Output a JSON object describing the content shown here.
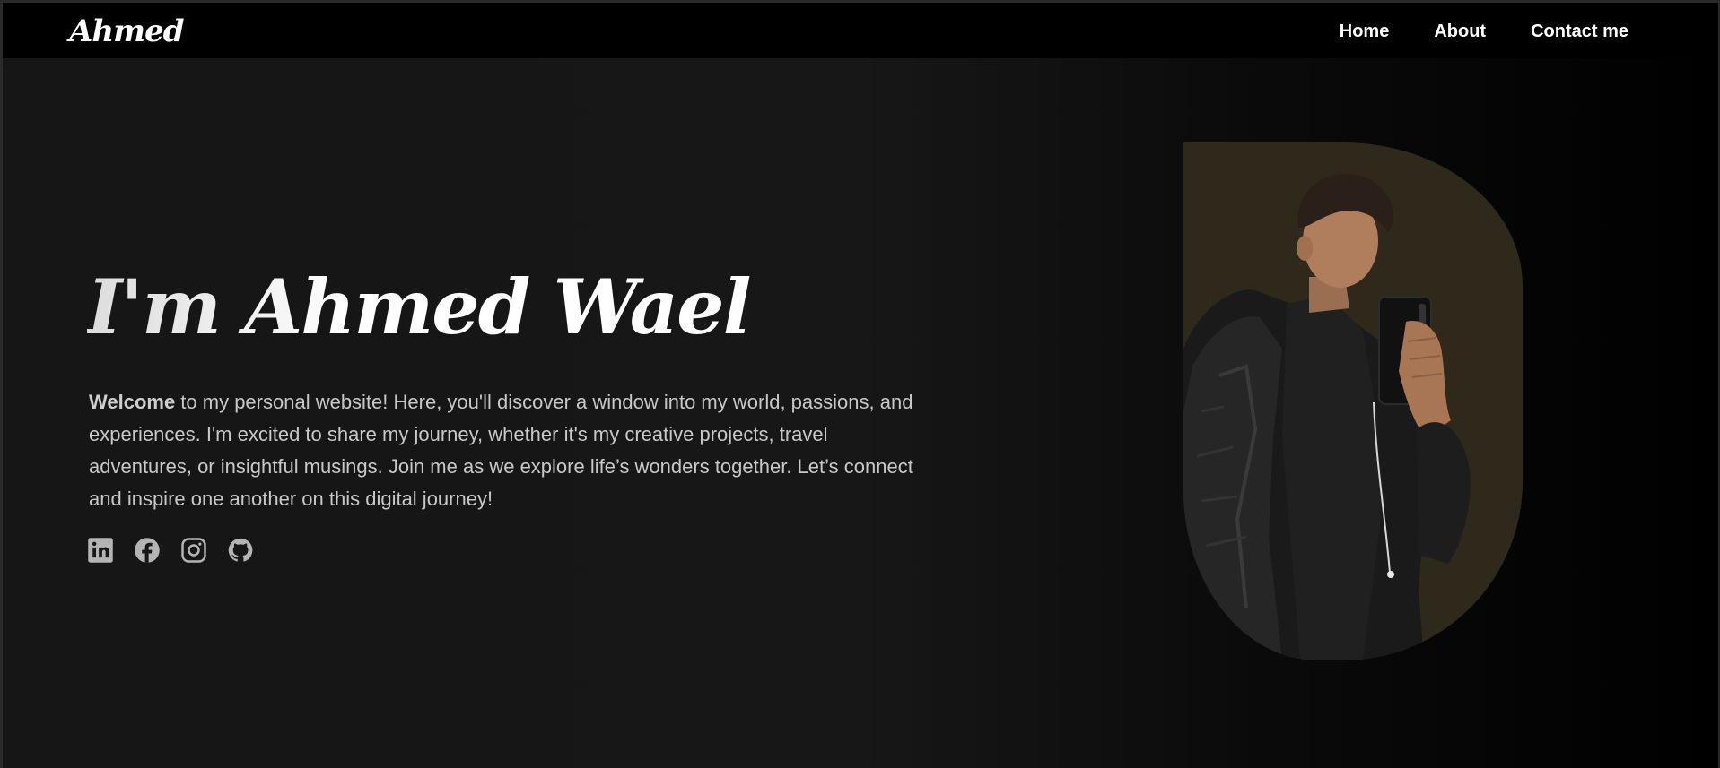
{
  "navbar": {
    "brand": "Ahmed",
    "links": [
      "Home",
      "About",
      "Contact me"
    ]
  },
  "hero": {
    "title": "I'm Ahmed Wael",
    "intro_bold": "Welcome",
    "intro_rest": " to my personal website! Here, you'll discover a window into my world, passions, and experiences. I'm excited to share my journey, whether it's my creative projects, travel adventures, or insightful musings. Join me as we explore life’s wonders together. Let’s connect and inspire one another on this digital journey!"
  },
  "socials": [
    {
      "icon": "linkedin-icon"
    },
    {
      "icon": "facebook-icon"
    },
    {
      "icon": "instagram-icon"
    },
    {
      "icon": "github-icon"
    }
  ],
  "colors": {
    "navbar_bg": "#000000",
    "portrait_bg": "#2f291c",
    "text_muted": "#c8c8c8",
    "icon_color": "#b4b4b4"
  }
}
